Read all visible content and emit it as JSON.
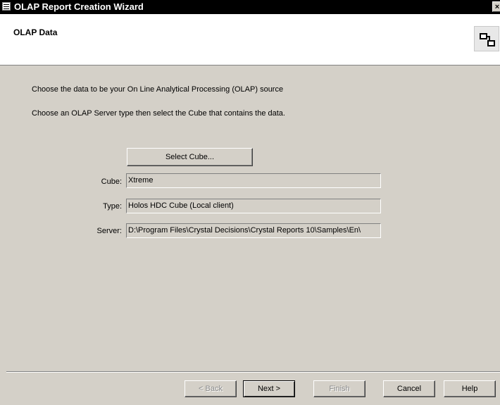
{
  "window": {
    "title": "OLAP Report Creation Wizard",
    "close_glyph": "×"
  },
  "header": {
    "title": "OLAP Data",
    "icon": "wizard-step-icon"
  },
  "instructions": {
    "line1": "Choose the data to be your On Line Analytical Processing (OLAP) source",
    "line2": "Choose an OLAP Server type then select the Cube that contains the data."
  },
  "select_cube_label": "Select Cube...",
  "fields": {
    "cube_label": "Cube:",
    "cube_value": "Xtreme",
    "type_label": "Type:",
    "type_value": "Holos HDC Cube (Local client)",
    "server_label": "Server:",
    "server_value": "D:\\Program Files\\Crystal Decisions\\Crystal Reports 10\\Samples\\En\\"
  },
  "buttons": {
    "back": "< Back",
    "next": "Next >",
    "finish": "Finish",
    "cancel": "Cancel",
    "help": "Help"
  },
  "colors": {
    "dialog_face": "#d4d0c8",
    "titlebar": "#000000"
  }
}
